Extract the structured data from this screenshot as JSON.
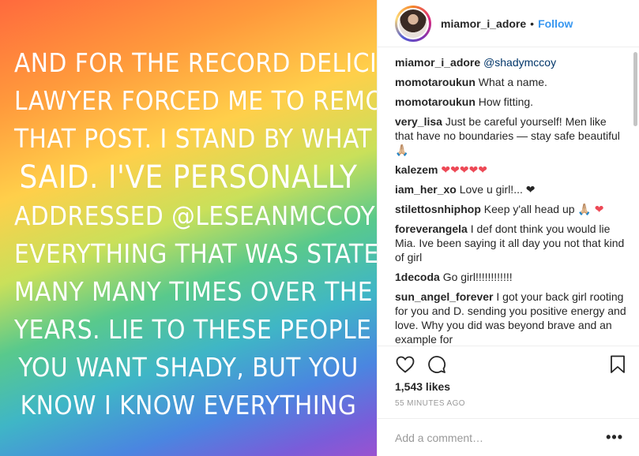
{
  "media": {
    "lines": [
      "AND FOR THE RECORD DELICIA'S",
      "LAWYER FORCED ME TO REMOVE",
      "THAT POST. I STAND BY WHAT I",
      "SAID. I'VE PERSONALLY",
      "ADDRESSED @LESEANMCCOY ON",
      "EVERYTHING THAT WAS STATED",
      "MANY MANY TIMES OVER THE",
      "YEARS. LIE TO THESE PEOPLE IF",
      "YOU WANT SHADY, BUT YOU",
      "KNOW I KNOW EVERYTHING"
    ]
  },
  "header": {
    "username": "miamor_i_adore",
    "separator": "•",
    "follow_label": "Follow"
  },
  "comments": [
    {
      "user": "miamor_i_adore",
      "text": "",
      "mention": "@shadymccoy"
    },
    {
      "user": "momotaroukun",
      "text": "What a name."
    },
    {
      "user": "momotaroukun",
      "text": "How fitting."
    },
    {
      "user": "very_lisa",
      "text": "Just be careful yourself! Men like that have no boundaries — stay safe beautiful 🙏🏼"
    },
    {
      "user": "kalezem",
      "text": "",
      "hearts": "❤❤❤❤❤"
    },
    {
      "user": "iam_her_xo",
      "text": "Love u girl!... ❤"
    },
    {
      "user": "stilettosnhiphop",
      "text": "Keep y'all head up 🙏🏼",
      "hearts": "❤"
    },
    {
      "user": "foreverangela",
      "text": "I def dont think you would lie Mia. Ive been saying it all day you not that kind of girl"
    },
    {
      "user": "1decoda",
      "text": "Go girl!!!!!!!!!!!!"
    },
    {
      "user": "sun_angel_forever",
      "text": "I got your back girl rooting for you and D. sending you positive energy and love. Why you did was beyond brave and an example for"
    }
  ],
  "icons": {
    "like": "heart-outline-icon",
    "comment": "speech-bubble-icon",
    "save": "bookmark-icon",
    "more": "ellipsis-icon"
  },
  "likes_text": "1,543 likes",
  "time_text": "55 MINUTES AGO",
  "add_comment": {
    "placeholder": "Add a comment…",
    "more_label": "•••"
  },
  "colors": {
    "link": "#3897f0",
    "heart": "#ed4956"
  }
}
